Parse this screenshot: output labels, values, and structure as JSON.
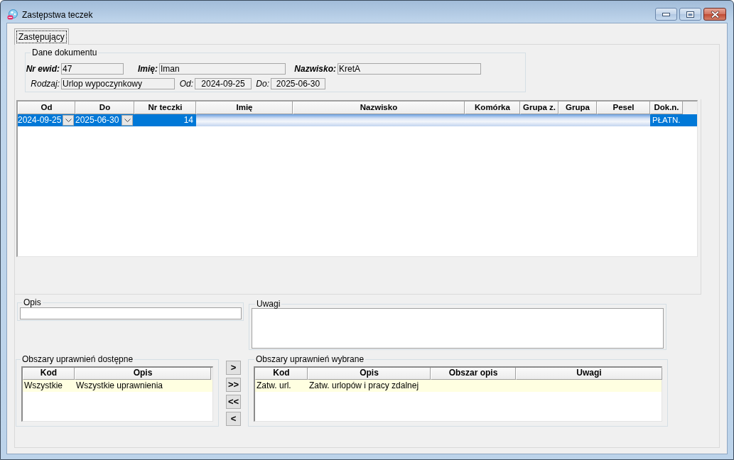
{
  "window": {
    "title": "Zastępstwa teczek"
  },
  "tabs": [
    {
      "label": "Zastępujący",
      "selected": true
    }
  ],
  "document": {
    "legend": "Dane dokumentu",
    "rows": [
      {
        "fields": [
          {
            "label": "Nr ewid:",
            "value": "47",
            "bold": true,
            "kind": "text"
          },
          {
            "label": "Imię:",
            "value": "Iman",
            "bold": true,
            "kind": "text"
          },
          {
            "label": "Nazwisko:",
            "value": "KretA",
            "bold": true,
            "kind": "text"
          }
        ]
      },
      {
        "fields": [
          {
            "label": "Rodzaj:",
            "value": "Urlop wypoczynkowy",
            "bold": false,
            "kind": "text"
          },
          {
            "label": "Od:",
            "value": "2024-09-25",
            "bold": false,
            "kind": "date"
          },
          {
            "label": "Do:",
            "value": "2025-06-30",
            "bold": false,
            "kind": "date"
          }
        ]
      }
    ]
  },
  "grid": {
    "columns": [
      "Od",
      "Do",
      "Nr teczki",
      "Imię",
      "Nazwisko",
      "Komórka",
      "Grupa z.",
      "Grupa",
      "Pesel",
      "Dok.n."
    ],
    "rows": [
      {
        "selected": true,
        "cells": [
          {
            "kind": "date",
            "text": "2024-09-25"
          },
          {
            "kind": "date",
            "text": "2025-06-30"
          },
          {
            "kind": "number",
            "text": "14"
          },
          {
            "kind": "blurred"
          },
          {
            "kind": "blurred"
          },
          {
            "kind": "blurred"
          },
          {
            "kind": "blurred"
          },
          {
            "kind": "blurred"
          },
          {
            "kind": "blurred"
          },
          {
            "kind": "text",
            "text": "PŁATN."
          }
        ]
      }
    ]
  },
  "opis": {
    "legend": "Opis"
  },
  "uwagi": {
    "legend": "Uwagi"
  },
  "available": {
    "legend": "Obszary uprawnień dostępne",
    "columns": [
      "Kod",
      "Opis"
    ],
    "rows": [
      {
        "selected": true,
        "cells": [
          "Wszystkie",
          "Wszystkie uprawnienia"
        ]
      }
    ]
  },
  "move_buttons": [
    ">",
    ">>",
    "<<",
    "<"
  ],
  "chosen": {
    "legend": "Obszary uprawnień wybrane",
    "columns": [
      "Kod",
      "Opis",
      "Obszar opis",
      "Uwagi"
    ],
    "rows": [
      {
        "selected": true,
        "cells": [
          "Zatw. url.",
          "Zatw. urlopów i pracy zdalnej"
        ]
      }
    ]
  }
}
